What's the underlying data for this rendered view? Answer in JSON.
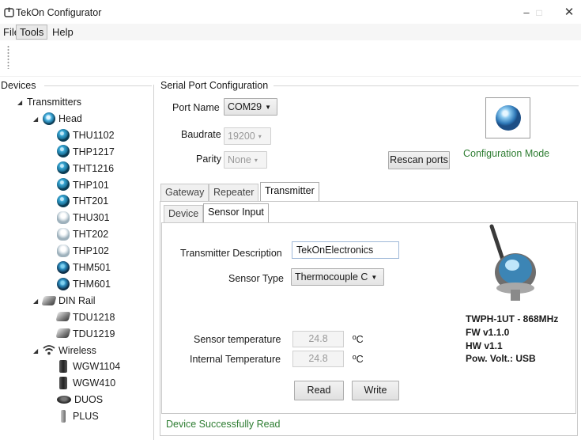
{
  "window": {
    "title": "TekOn Configurator",
    "minimize": "–",
    "maximize": "□",
    "close": "✕"
  },
  "menu": [
    "File",
    "Tools",
    "Help"
  ],
  "devices": {
    "header": "Devices",
    "tree": [
      {
        "label": "Transmitters",
        "level": 0,
        "expanded": true,
        "icon": "none"
      },
      {
        "label": "Head",
        "level": 1,
        "expanded": true,
        "icon": "head-group-icon"
      },
      {
        "label": "THU1102",
        "level": 2,
        "icon": "head-transmitter-icon"
      },
      {
        "label": "THP1217",
        "level": 2,
        "icon": "head-transmitter-icon"
      },
      {
        "label": "THT1216",
        "level": 2,
        "icon": "head-transmitter-icon"
      },
      {
        "label": "THP101",
        "level": 2,
        "icon": "head-transmitter-icon"
      },
      {
        "label": "THT201",
        "level": 2,
        "icon": "head-transmitter-icon"
      },
      {
        "label": "THU301",
        "level": 2,
        "icon": "white-head-icon"
      },
      {
        "label": "THT202",
        "level": 2,
        "icon": "white-head-icon"
      },
      {
        "label": "THP102",
        "level": 2,
        "icon": "white-head-icon"
      },
      {
        "label": "THM501",
        "level": 2,
        "icon": "ball-head-icon"
      },
      {
        "label": "THM601",
        "level": 2,
        "icon": "ball-head-icon"
      },
      {
        "label": "DIN Rail",
        "level": 1,
        "expanded": true,
        "icon": "din-rail-icon"
      },
      {
        "label": "TDU1218",
        "level": 2,
        "icon": "din-rail-icon"
      },
      {
        "label": "TDU1219",
        "level": 2,
        "icon": "din-rail-icon"
      },
      {
        "label": "Wireless",
        "level": 1,
        "expanded": true,
        "icon": "wifi-icon"
      },
      {
        "label": "WGW1104",
        "level": 2,
        "icon": "gateway-icon"
      },
      {
        "label": "WGW410",
        "level": 2,
        "icon": "gateway-icon"
      },
      {
        "label": "DUOS",
        "level": 2,
        "icon": "duos-icon"
      },
      {
        "label": "PLUS",
        "level": 2,
        "icon": "plus-probe-icon"
      }
    ]
  },
  "serial": {
    "header": "Serial Port Configuration",
    "port_label": "Port Name",
    "port_value": "COM29",
    "baud_label": "Baudrate",
    "baud_value": "19200",
    "parity_label": "Parity",
    "parity_value": "None",
    "rescan": "Rescan ports",
    "config_mode": "Configuration Mode"
  },
  "tabs": [
    "Gateway",
    "Repeater",
    "Transmitter"
  ],
  "subtabs": [
    "Device",
    "Sensor Input"
  ],
  "sensor": {
    "desc_label": "Transmitter Description",
    "desc_value": "TekOnElectronics",
    "type_label": "Sensor Type",
    "type_value": "Thermocouple C",
    "temp_label": "Sensor temperature",
    "temp_value": "24.8",
    "temp_unit": "ºC",
    "int_label": "Internal Temperature",
    "int_value": "24.8",
    "int_unit": "ºC",
    "read": "Read",
    "write": "Write"
  },
  "device_info": {
    "model": "TWPH-1UT - 868MHz",
    "fw": "FW v1.1.0",
    "hw": "HW v1.1",
    "power": "Pow. Volt.: USB"
  },
  "status": "Device Successfully Read",
  "colors": {
    "status_green": "#2e7d32",
    "accent_blue": "#2f79b8"
  }
}
